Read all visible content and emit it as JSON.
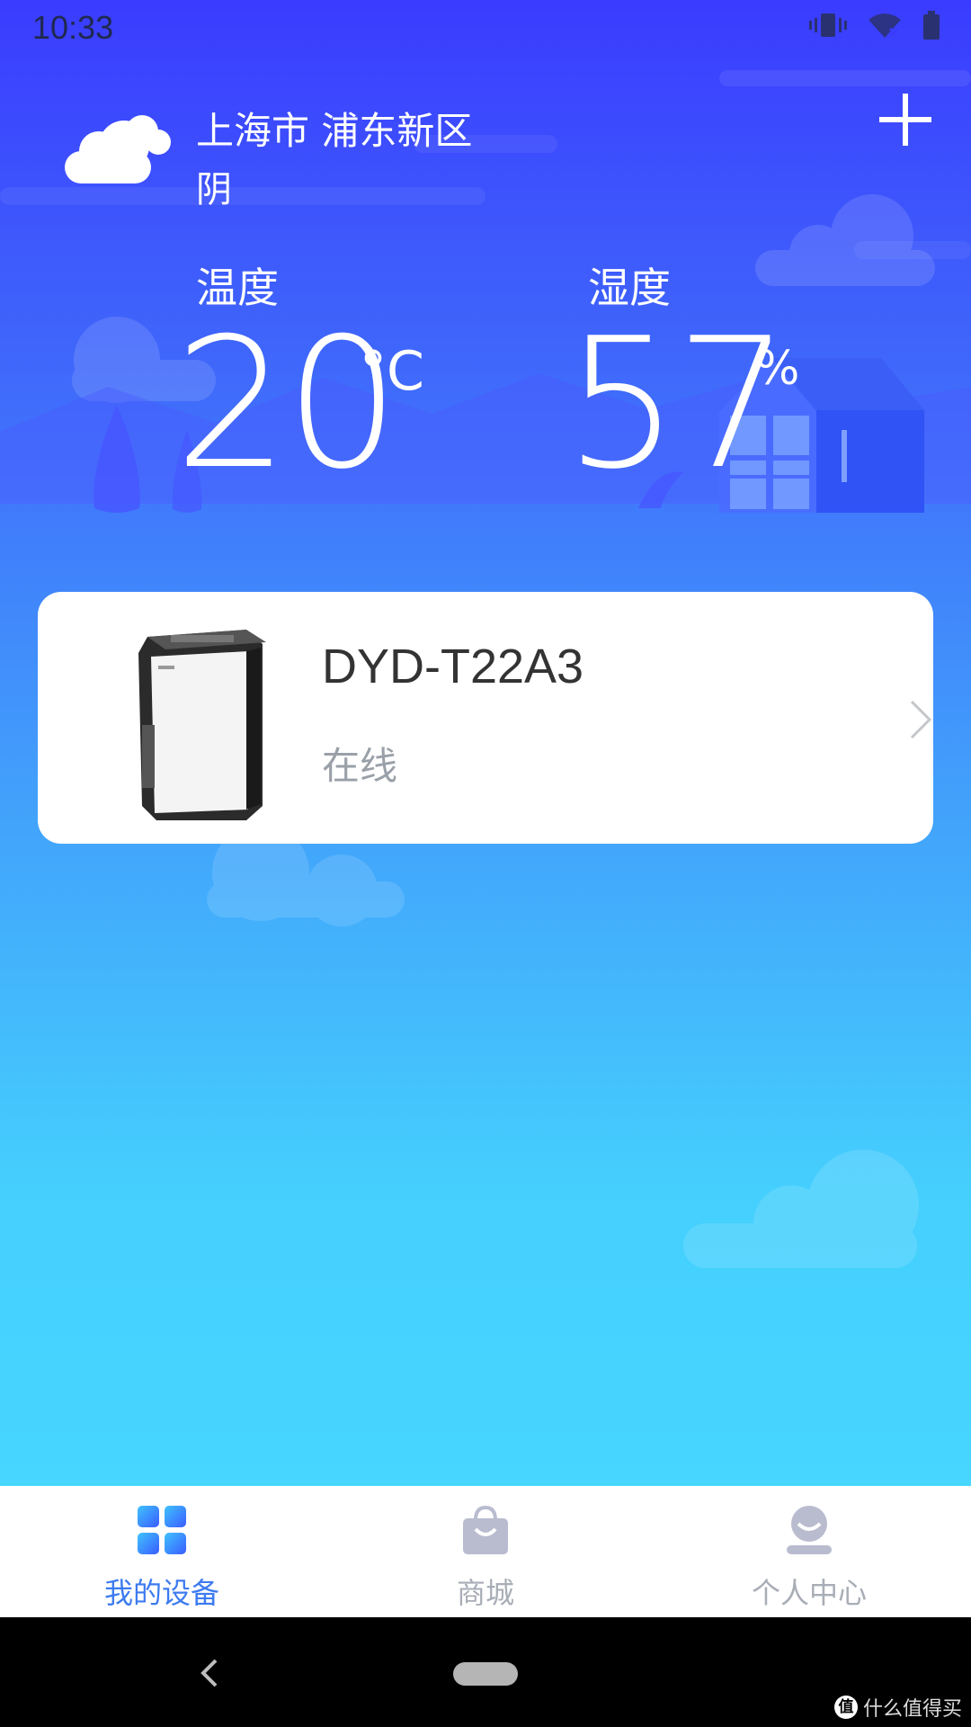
{
  "status_bar": {
    "time": "10:33",
    "icons": [
      "vibrate-icon",
      "wifi-off-icon",
      "battery-icon"
    ]
  },
  "weather": {
    "location": "上海市 浦东新区",
    "condition": "阴",
    "icon": "cloudy-icon"
  },
  "header": {
    "add_icon": "plus-icon"
  },
  "metrics": {
    "temperature": {
      "label": "温度",
      "value": "20",
      "unit": "°C"
    },
    "humidity": {
      "label": "湿度",
      "value": "57",
      "unit": "%"
    }
  },
  "devices": [
    {
      "name": "DYD-T22A3",
      "status": "在线",
      "image": "dehumidifier-image"
    }
  ],
  "bottom_nav": [
    {
      "label": "我的设备",
      "icon": "grid-icon",
      "active": true
    },
    {
      "label": "商城",
      "icon": "shopping-bag-icon",
      "active": false
    },
    {
      "label": "个人中心",
      "icon": "user-icon",
      "active": false
    }
  ],
  "watermark": {
    "badge": "值",
    "text": "什么值得买"
  },
  "colors": {
    "accent": "#3d7bf0",
    "inactive": "#a8adb6",
    "gradient_top": "#3a3cff",
    "gradient_bottom": "#46d6ff"
  }
}
